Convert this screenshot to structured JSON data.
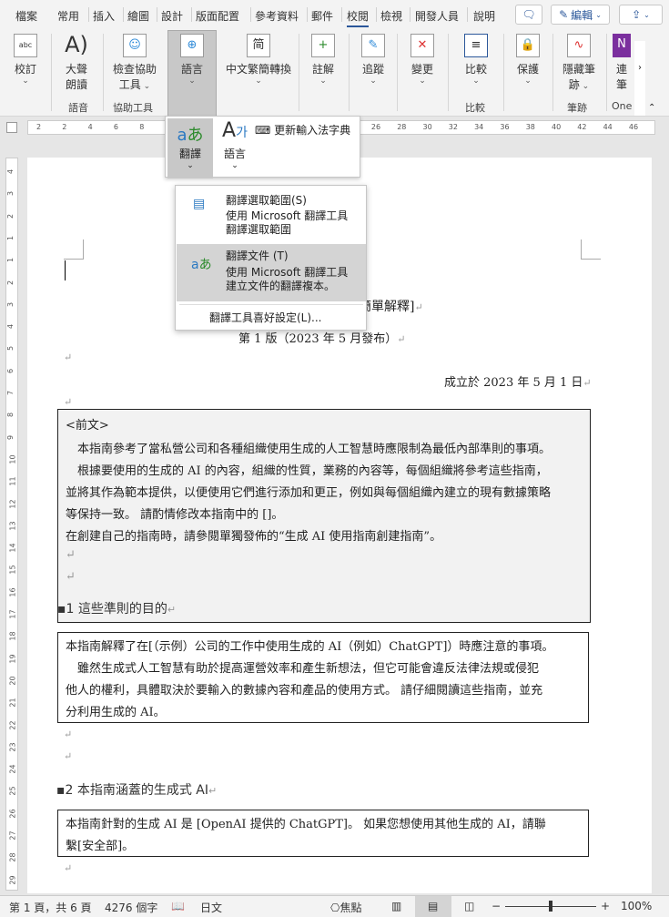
{
  "tabs": [
    "檔案",
    "常用",
    "插入",
    "繪圖",
    "設計",
    "版面配置",
    "參考資料",
    "郵件",
    "校閱",
    "檢視",
    "開發人員",
    "說明"
  ],
  "active_tab": "校閱",
  "top_buttons": {
    "comment_icon": "comment-icon",
    "edit_label": "編輯",
    "share_icon": "share-icon"
  },
  "ribbon": {
    "proofing": "校訂",
    "read_aloud": [
      "大聲",
      "朗讀"
    ],
    "accessibility": [
      "檢查協助",
      "工具"
    ],
    "language": "語言",
    "zh_convert": "中文繁簡轉換",
    "comments": "註解",
    "tracking": "追蹤",
    "changes": "變更",
    "compare": "比較",
    "protect": "保護",
    "ink": [
      "隱藏筆",
      "跡"
    ],
    "onenote": [
      "連",
      "筆"
    ],
    "groups": {
      "speech": "語音",
      "accessibility": "協助工具",
      "compare": "比較",
      "ink": "筆跡",
      "onenote": "One"
    }
  },
  "ruler_numbers": [
    "2",
    "2",
    "4",
    "6",
    "8",
    "10",
    "12",
    "14",
    "16",
    "18",
    "20",
    "22",
    "24",
    "26",
    "28",
    "30",
    "32",
    "34",
    "36",
    "38",
    "40",
    "42",
    "44",
    "46"
  ],
  "vruler_numbers": [
    "4",
    "3",
    "2",
    "1",
    "1",
    "2",
    "3",
    "4",
    "5",
    "6",
    "7",
    "8",
    "9",
    "10",
    "11",
    "12",
    "13",
    "14",
    "15",
    "16",
    "17",
    "18",
    "19",
    "20",
    "21",
    "22",
    "23",
    "24",
    "25",
    "26",
    "27",
    "28",
    "29"
  ],
  "language_popup": {
    "translate": "翻譯",
    "language": "語言",
    "update_ime": "更新輸入法字典"
  },
  "translate_menu": {
    "items": [
      {
        "title": "翻譯選取範圍(S)",
        "desc": [
          "使用 Microsoft 翻譯工具",
          "翻譯選取範圍"
        ]
      },
      {
        "title": "翻譯文件 (T)",
        "desc": [
          "使用 Microsoft 翻譯工具",
          "建立文件的翻譯複本。"
        ]
      }
    ],
    "preferences": "翻譯工具喜好設定(L)..."
  },
  "document": {
    "title_fragment": "簡單解釋]",
    "edition": "第 1 版（2023 年 5 月發布）",
    "established": "成立於 2023 年 5 月 1 日",
    "preface": [
      "<前文>",
      "　本指南參考了當私營公司和各種組織使用生成的人工智慧時應限制為最低內部準則的事項。",
      "　根據要使用的生成的 AI 的內容，組織的性質，業務的內容等，每個組織將參考這些指南，",
      "並將其作為範本提供，以便使用它們進行添加和更正，例如與每個組織內建立的現有數據策略",
      "等保持一致。 請酌情修改本指南中的 []。",
      "在創建自己的指南時，請參閱單獨發佈的“生成 AI 使用指南創建指南”。"
    ],
    "section1": "1 這些準則的目的",
    "section1_box": [
      "本指南解釋了在[（示例）公司的工作中使用生成的 AI（例如）ChatGPT]）時應注意的事項。",
      "　雖然生成式人工智慧有助於提高運營效率和產生新想法，但它可能會違反法律法規或侵犯",
      "他人的權利，具體取決於要輸入的數據內容和產品的使用方式。 請仔細閱讀這些指南，並充",
      "分利用生成的 AI。"
    ],
    "section2": "2 本指南涵蓋的生成式 AI",
    "section2_box": [
      "本指南針對的生成 AI 是 [OpenAI 提供的 ChatGPT]。 如果您想使用其他生成的 AI，請聯",
      "繫[安全部]。"
    ]
  },
  "status": {
    "page": "第 1 頁，共 6 頁",
    "words": "4276 個字",
    "language": "日文",
    "focus": "焦點",
    "zoom": "100%",
    "zoom_level": 100
  }
}
